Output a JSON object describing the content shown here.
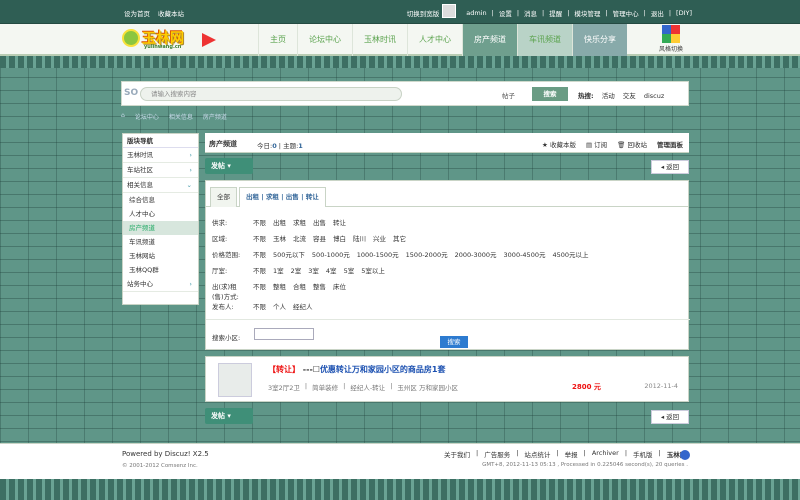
{
  "topbar": {
    "set_home": "设为首页",
    "bookmark": "收藏本站",
    "switch_mode": "切换到宽版",
    "user": "admin",
    "links": [
      "设置",
      "消息",
      "提醒",
      "模块管理",
      "管理中心",
      "退出",
      "[DIY]"
    ]
  },
  "logo": {
    "text": "玉林网",
    "sub": "yulinwang.cn"
  },
  "nav": {
    "items": [
      "主页",
      "论坛中心",
      "玉林时讯",
      "人才中心",
      "房产频道",
      "车讯频道",
      "快乐分享"
    ],
    "active": "房产频道",
    "style_switch": "风格切换"
  },
  "search": {
    "logo": "SO",
    "placeholder": "请输入搜索内容",
    "scope": "帖子",
    "button": "搜索",
    "hot_label": "热搜:",
    "hot": [
      "活动",
      "交友",
      "discuz"
    ]
  },
  "breadcrumb": [
    "论坛中心",
    "相关信息",
    "房产频道"
  ],
  "sidebar": {
    "title": "版块导航",
    "items": [
      {
        "label": "玉林时讯"
      },
      {
        "label": "车站社区"
      },
      {
        "label": "相关信息"
      }
    ],
    "subitems": [
      "综合信息",
      "人才中心",
      "房产频道",
      "车讯频道",
      "玉林网站",
      "玉林QQ群"
    ],
    "active_sub": "房产频道",
    "last": "站务中心"
  },
  "forum": {
    "title": "房产频道",
    "today_label": "今日:",
    "today": "0",
    "topics_label": "主题:",
    "topics": "1",
    "actions": [
      "收藏本版",
      "订阅",
      "回收站",
      "管理面板"
    ]
  },
  "post_button": "发帖",
  "back_button": "返回",
  "filters": {
    "tabs": [
      "全部",
      "出租 | 求租 | 出售 | 转让"
    ],
    "rows": [
      {
        "k": "供求:",
        "v": [
          "不限",
          "出租",
          "求租",
          "出售",
          "转让"
        ]
      },
      {
        "k": "区域:",
        "v": [
          "不限",
          "玉林",
          "北流",
          "容县",
          "博白",
          "陆川",
          "兴业",
          "其它"
        ]
      },
      {
        "k": "价格范围:",
        "v": [
          "不限",
          "500元以下",
          "500-1000元",
          "1000-1500元",
          "1500-2000元",
          "2000-3000元",
          "3000-4500元",
          "4500元以上"
        ]
      },
      {
        "k": "厅室:",
        "v": [
          "不限",
          "1室",
          "2室",
          "3室",
          "4室",
          "5室",
          "5室以上"
        ]
      },
      {
        "k": "出(求)租(售)方式:",
        "v": [
          "不限",
          "整租",
          "合租",
          "整售",
          "床位"
        ]
      },
      {
        "k": "发布人:",
        "v": [
          "不限",
          "个人",
          "经纪人"
        ]
      }
    ],
    "area_label": "搜索小区:",
    "search_btn": "搜索"
  },
  "thread": {
    "tag": "【转让】",
    "sep": "---",
    "title": "优惠转让万和家园小区的商品房1套",
    "meta": [
      "3室2厅2卫",
      "简单装修",
      "经纪人-转让",
      "玉州区 万和家园小区"
    ],
    "price": "2800 元",
    "date": "2012-11-4"
  },
  "footer": {
    "powered": "Powered by Discuz! X2.5",
    "copyright": "© 2001-2012 Comsenz Inc.",
    "links": [
      "关于我们",
      "广告服务",
      "站点统计",
      "举报",
      "Archiver",
      "手机版",
      "玉林网"
    ],
    "gmt": "GMT+8, 2012-11-13 05:13 , Processed in 0.225046 second(s), 20 queries ."
  },
  "colors": {
    "accent": "#3f8f78",
    "bg": "#5f9688",
    "link": "#1a4fb0",
    "red": "#e11"
  }
}
